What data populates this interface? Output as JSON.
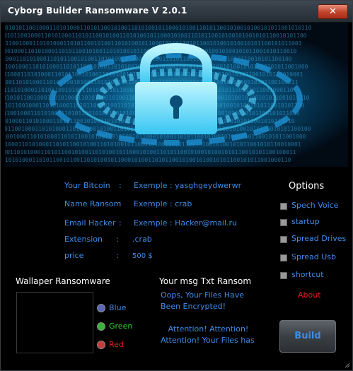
{
  "window": {
    "title": "Cyborg Builder Ransomware V 2.0.1",
    "close_glyph": "✕"
  },
  "banner": {
    "icon": "padlock-icon",
    "binary_text": "0101011001000110101000110101100101001101010010110001010011010110010100101001010110"
  },
  "form": {
    "fields": [
      {
        "label": "Your Bitcoin",
        "sep": ":",
        "value": "Exemple : yasghgeydwerwr"
      },
      {
        "label": "Name Ransom",
        "sep": ":",
        "value": "Exemple : crab"
      },
      {
        "label": "Email Hacker",
        "sep": ":",
        "value": "Exemple : Hacker@mail.ru"
      },
      {
        "label": "Extension",
        "sep": ":",
        "value": ".crab"
      },
      {
        "label": "price",
        "sep": ":",
        "value": "500 $"
      }
    ]
  },
  "options": {
    "title": "Options",
    "items": [
      "Spech Voice",
      "startup",
      "Spread Drives",
      "Spread Usb",
      "shortcut"
    ],
    "about_label": "About",
    "build_label": "Build"
  },
  "wallpaper": {
    "label": "Wallaper Ransomware",
    "colors": [
      {
        "label": "Blue",
        "color": "#3f8ce8",
        "dot": "#5a67b8"
      },
      {
        "label": "Green",
        "color": "#2fcf2f",
        "dot": "#39b239"
      },
      {
        "label": "Red",
        "color": "#e21f1f",
        "dot": "#c73b3b"
      }
    ]
  },
  "message": {
    "label": "Your msg Txt Ransom",
    "lines": [
      "Oops, Your Files Have",
      "Been Encrypted!",
      "",
      "   Attention! Attention!",
      "Attention! Your Files has"
    ]
  }
}
